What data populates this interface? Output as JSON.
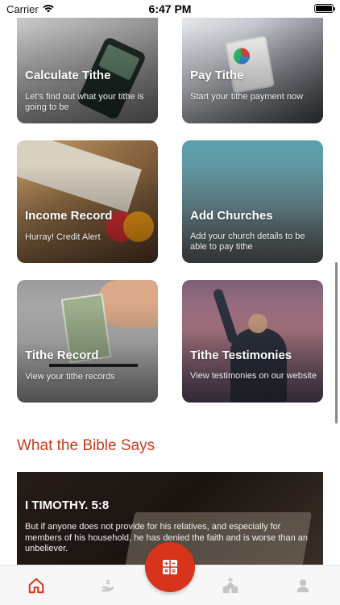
{
  "status_bar": {
    "carrier": "Carrier",
    "time": "6:47 PM"
  },
  "cards": [
    {
      "title": "Calculate Tithe",
      "description": "Let's find out what your tithe is going to be"
    },
    {
      "title": "Pay Tithe",
      "description": "Start your tithe payment now"
    },
    {
      "title": "Income Record",
      "description": "Hurray! Credit Alert"
    },
    {
      "title": "Add Churches",
      "description": "Add your church details to be able to pay tithe"
    },
    {
      "title": "Tithe Record",
      "description": "View your tithe records"
    },
    {
      "title": "Tithe Testimonies",
      "description": "View testimonies on our website"
    }
  ],
  "section": {
    "title": "What the Bible Says"
  },
  "bible_verse": {
    "reference": "I TIMOTHY. 5:8",
    "text": "But if anyone does not provide for his relatives, and especially for members of his household, he has denied the faith and is worse than an unbeliever."
  },
  "tab_bar": {
    "active_color": "#d7341b",
    "inactive_color": "#c4c4c4",
    "items": [
      "home-icon",
      "giving-hand-icon",
      "calculator-icon",
      "church-icon",
      "profile-icon"
    ]
  }
}
